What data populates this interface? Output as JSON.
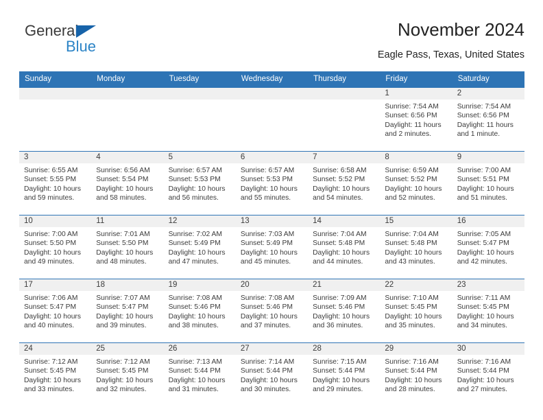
{
  "brand": {
    "name_part1": "General",
    "name_part2": "Blue",
    "triangle_color": "#1763a9",
    "blue_color": "#2b83c6"
  },
  "header": {
    "title": "November 2024",
    "location": "Eagle Pass, Texas, United States"
  },
  "theme": {
    "header_blue": "#2e74b5",
    "daynum_band": "#f0f0f0",
    "text": "#3b3b3b"
  },
  "weekday_headers": [
    "Sunday",
    "Monday",
    "Tuesday",
    "Wednesday",
    "Thursday",
    "Friday",
    "Saturday"
  ],
  "labels": {
    "sunrise": "Sunrise:",
    "sunset": "Sunset:",
    "daylight": "Daylight:"
  },
  "weeks": [
    [
      {
        "day": "",
        "empty": true
      },
      {
        "day": "",
        "empty": true
      },
      {
        "day": "",
        "empty": true
      },
      {
        "day": "",
        "empty": true
      },
      {
        "day": "",
        "empty": true
      },
      {
        "day": "1",
        "sunrise": "Sunrise: 7:54 AM",
        "sunset": "Sunset: 6:56 PM",
        "daylight_line1": "Daylight: 11 hours",
        "daylight_line2": "and 2 minutes."
      },
      {
        "day": "2",
        "sunrise": "Sunrise: 7:54 AM",
        "sunset": "Sunset: 6:56 PM",
        "daylight_line1": "Daylight: 11 hours",
        "daylight_line2": "and 1 minute."
      }
    ],
    [
      {
        "day": "3",
        "sunrise": "Sunrise: 6:55 AM",
        "sunset": "Sunset: 5:55 PM",
        "daylight_line1": "Daylight: 10 hours",
        "daylight_line2": "and 59 minutes."
      },
      {
        "day": "4",
        "sunrise": "Sunrise: 6:56 AM",
        "sunset": "Sunset: 5:54 PM",
        "daylight_line1": "Daylight: 10 hours",
        "daylight_line2": "and 58 minutes."
      },
      {
        "day": "5",
        "sunrise": "Sunrise: 6:57 AM",
        "sunset": "Sunset: 5:53 PM",
        "daylight_line1": "Daylight: 10 hours",
        "daylight_line2": "and 56 minutes."
      },
      {
        "day": "6",
        "sunrise": "Sunrise: 6:57 AM",
        "sunset": "Sunset: 5:53 PM",
        "daylight_line1": "Daylight: 10 hours",
        "daylight_line2": "and 55 minutes."
      },
      {
        "day": "7",
        "sunrise": "Sunrise: 6:58 AM",
        "sunset": "Sunset: 5:52 PM",
        "daylight_line1": "Daylight: 10 hours",
        "daylight_line2": "and 54 minutes."
      },
      {
        "day": "8",
        "sunrise": "Sunrise: 6:59 AM",
        "sunset": "Sunset: 5:52 PM",
        "daylight_line1": "Daylight: 10 hours",
        "daylight_line2": "and 52 minutes."
      },
      {
        "day": "9",
        "sunrise": "Sunrise: 7:00 AM",
        "sunset": "Sunset: 5:51 PM",
        "daylight_line1": "Daylight: 10 hours",
        "daylight_line2": "and 51 minutes."
      }
    ],
    [
      {
        "day": "10",
        "sunrise": "Sunrise: 7:00 AM",
        "sunset": "Sunset: 5:50 PM",
        "daylight_line1": "Daylight: 10 hours",
        "daylight_line2": "and 49 minutes."
      },
      {
        "day": "11",
        "sunrise": "Sunrise: 7:01 AM",
        "sunset": "Sunset: 5:50 PM",
        "daylight_line1": "Daylight: 10 hours",
        "daylight_line2": "and 48 minutes."
      },
      {
        "day": "12",
        "sunrise": "Sunrise: 7:02 AM",
        "sunset": "Sunset: 5:49 PM",
        "daylight_line1": "Daylight: 10 hours",
        "daylight_line2": "and 47 minutes."
      },
      {
        "day": "13",
        "sunrise": "Sunrise: 7:03 AM",
        "sunset": "Sunset: 5:49 PM",
        "daylight_line1": "Daylight: 10 hours",
        "daylight_line2": "and 45 minutes."
      },
      {
        "day": "14",
        "sunrise": "Sunrise: 7:04 AM",
        "sunset": "Sunset: 5:48 PM",
        "daylight_line1": "Daylight: 10 hours",
        "daylight_line2": "and 44 minutes."
      },
      {
        "day": "15",
        "sunrise": "Sunrise: 7:04 AM",
        "sunset": "Sunset: 5:48 PM",
        "daylight_line1": "Daylight: 10 hours",
        "daylight_line2": "and 43 minutes."
      },
      {
        "day": "16",
        "sunrise": "Sunrise: 7:05 AM",
        "sunset": "Sunset: 5:47 PM",
        "daylight_line1": "Daylight: 10 hours",
        "daylight_line2": "and 42 minutes."
      }
    ],
    [
      {
        "day": "17",
        "sunrise": "Sunrise: 7:06 AM",
        "sunset": "Sunset: 5:47 PM",
        "daylight_line1": "Daylight: 10 hours",
        "daylight_line2": "and 40 minutes."
      },
      {
        "day": "18",
        "sunrise": "Sunrise: 7:07 AM",
        "sunset": "Sunset: 5:47 PM",
        "daylight_line1": "Daylight: 10 hours",
        "daylight_line2": "and 39 minutes."
      },
      {
        "day": "19",
        "sunrise": "Sunrise: 7:08 AM",
        "sunset": "Sunset: 5:46 PM",
        "daylight_line1": "Daylight: 10 hours",
        "daylight_line2": "and 38 minutes."
      },
      {
        "day": "20",
        "sunrise": "Sunrise: 7:08 AM",
        "sunset": "Sunset: 5:46 PM",
        "daylight_line1": "Daylight: 10 hours",
        "daylight_line2": "and 37 minutes."
      },
      {
        "day": "21",
        "sunrise": "Sunrise: 7:09 AM",
        "sunset": "Sunset: 5:46 PM",
        "daylight_line1": "Daylight: 10 hours",
        "daylight_line2": "and 36 minutes."
      },
      {
        "day": "22",
        "sunrise": "Sunrise: 7:10 AM",
        "sunset": "Sunset: 5:45 PM",
        "daylight_line1": "Daylight: 10 hours",
        "daylight_line2": "and 35 minutes."
      },
      {
        "day": "23",
        "sunrise": "Sunrise: 7:11 AM",
        "sunset": "Sunset: 5:45 PM",
        "daylight_line1": "Daylight: 10 hours",
        "daylight_line2": "and 34 minutes."
      }
    ],
    [
      {
        "day": "24",
        "sunrise": "Sunrise: 7:12 AM",
        "sunset": "Sunset: 5:45 PM",
        "daylight_line1": "Daylight: 10 hours",
        "daylight_line2": "and 33 minutes."
      },
      {
        "day": "25",
        "sunrise": "Sunrise: 7:12 AM",
        "sunset": "Sunset: 5:45 PM",
        "daylight_line1": "Daylight: 10 hours",
        "daylight_line2": "and 32 minutes."
      },
      {
        "day": "26",
        "sunrise": "Sunrise: 7:13 AM",
        "sunset": "Sunset: 5:44 PM",
        "daylight_line1": "Daylight: 10 hours",
        "daylight_line2": "and 31 minutes."
      },
      {
        "day": "27",
        "sunrise": "Sunrise: 7:14 AM",
        "sunset": "Sunset: 5:44 PM",
        "daylight_line1": "Daylight: 10 hours",
        "daylight_line2": "and 30 minutes."
      },
      {
        "day": "28",
        "sunrise": "Sunrise: 7:15 AM",
        "sunset": "Sunset: 5:44 PM",
        "daylight_line1": "Daylight: 10 hours",
        "daylight_line2": "and 29 minutes."
      },
      {
        "day": "29",
        "sunrise": "Sunrise: 7:16 AM",
        "sunset": "Sunset: 5:44 PM",
        "daylight_line1": "Daylight: 10 hours",
        "daylight_line2": "and 28 minutes."
      },
      {
        "day": "30",
        "sunrise": "Sunrise: 7:16 AM",
        "sunset": "Sunset: 5:44 PM",
        "daylight_line1": "Daylight: 10 hours",
        "daylight_line2": "and 27 minutes."
      }
    ]
  ]
}
